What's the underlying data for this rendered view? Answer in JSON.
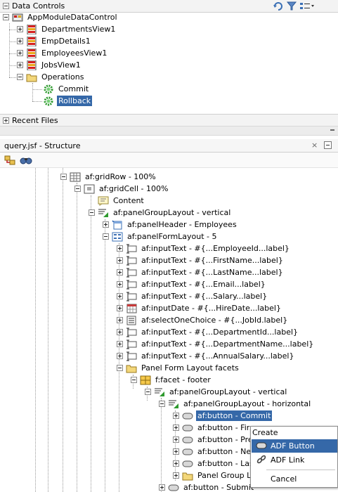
{
  "data_controls": {
    "title": "Data Controls",
    "tree": [
      {
        "label": "AppModuleDataControl",
        "icon": "data-control-icon"
      },
      {
        "label": "DepartmentsView1",
        "icon": "collection-icon"
      },
      {
        "label": "EmpDetails1",
        "icon": "collection-icon"
      },
      {
        "label": "EmployeesView1",
        "icon": "collection-icon"
      },
      {
        "label": "JobsView1",
        "icon": "collection-icon"
      },
      {
        "label": "Operations",
        "icon": "folder-icon"
      },
      {
        "label": "Commit",
        "icon": "operation-gear-icon"
      },
      {
        "label": "Rollback",
        "icon": "operation-gear-icon",
        "selected": true
      }
    ]
  },
  "recent_files": {
    "title": "Recent Files"
  },
  "structure": {
    "title": "query.jsf - Structure",
    "tree": [
      {
        "label": "af:gridRow - 100%"
      },
      {
        "label": "af:gridCell - 100%"
      },
      {
        "label": "Content"
      },
      {
        "label": "af:panelGroupLayout - vertical"
      },
      {
        "label": "af:panelHeader - Employees"
      },
      {
        "label": "af:panelFormLayout - 5"
      },
      {
        "label": "af:inputText - #{...EmployeeId...label}"
      },
      {
        "label": "af:inputText - #{...FirstName...label}"
      },
      {
        "label": "af:inputText - #{...LastName...label}"
      },
      {
        "label": "af:inputText - #{...Email...label}"
      },
      {
        "label": "af:inputText - #{...Salary...label}"
      },
      {
        "label": "af:inputDate - #{...HireDate...label}"
      },
      {
        "label": "af:selectOneChoice - #{...JobId.label}"
      },
      {
        "label": "af:inputText - #{...DepartmentId...label}"
      },
      {
        "label": "af:inputText - #{...DepartmentName...label}"
      },
      {
        "label": "af:inputText - #{...AnnualSalary...label}"
      },
      {
        "label": "Panel Form Layout facets"
      },
      {
        "label": "f:facet - footer"
      },
      {
        "label": "af:panelGroupLayout - vertical"
      },
      {
        "label": "af:panelGroupLayout - horizontal"
      },
      {
        "label": "af:button - Commit",
        "selected": true
      },
      {
        "label": "af:button - First"
      },
      {
        "label": "af:button - Previous"
      },
      {
        "label": "af:button - Next"
      },
      {
        "label": "af:button - Last"
      },
      {
        "label": "Panel Group Layout facets"
      },
      {
        "label": "af:button - Submit"
      }
    ]
  },
  "context_menu": {
    "header": "Create",
    "items": [
      {
        "label": "ADF Button",
        "icon": "button-icon",
        "highlighted": true
      },
      {
        "label": "ADF Link",
        "icon": "link-icon"
      },
      {
        "label": "Cancel"
      }
    ]
  },
  "colors": {
    "selection": "#3568a8",
    "menu_highlight": "#3568a8"
  }
}
